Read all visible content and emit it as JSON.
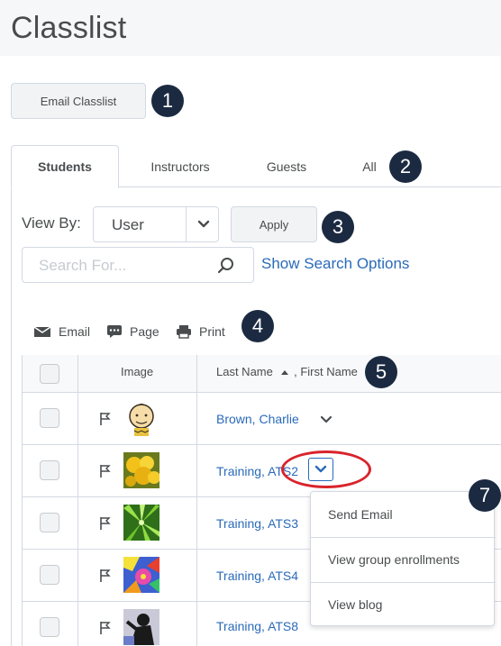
{
  "page": {
    "title": "Classlist"
  },
  "actions": {
    "email_classlist": "Email Classlist"
  },
  "tabs": [
    {
      "label": "Students",
      "active": true
    },
    {
      "label": "Instructors",
      "active": false
    },
    {
      "label": "Guests",
      "active": false
    },
    {
      "label": "All",
      "active": false
    }
  ],
  "filter": {
    "view_by_label": "View By:",
    "view_by_value": "User",
    "apply_label": "Apply",
    "search_placeholder": "Search For...",
    "search_options_link": "Show Search Options"
  },
  "toolbar": {
    "email": "Email",
    "page": "Page",
    "print": "Print"
  },
  "table": {
    "headers": {
      "image": "Image",
      "name_first": "Last Name",
      "name_sep": ", First Name"
    },
    "rows": [
      {
        "name": "Brown, Charlie",
        "avatar": "charlie-brown"
      },
      {
        "name": "Training, ATS2",
        "avatar": "yellow-flowers"
      },
      {
        "name": "Training, ATS3",
        "avatar": "green-leaves"
      },
      {
        "name": "Training, ATS4",
        "avatar": "colorful-art"
      },
      {
        "name": "Training, ATS8",
        "avatar": "silhouette"
      }
    ]
  },
  "context_menu": {
    "items": [
      "Send Email",
      "View group enrollments",
      "View blog"
    ]
  },
  "callouts": [
    "1",
    "2",
    "3",
    "4",
    "5",
    "7"
  ],
  "colors": {
    "link": "#2a6ab9",
    "callout": "#1b2a41",
    "highlight": "#d9232b"
  },
  "icons": [
    "envelope-icon",
    "chat-bubble-icon",
    "printer-icon",
    "search-icon",
    "chevron-down-icon",
    "flag-icon",
    "sort-up-icon"
  ]
}
